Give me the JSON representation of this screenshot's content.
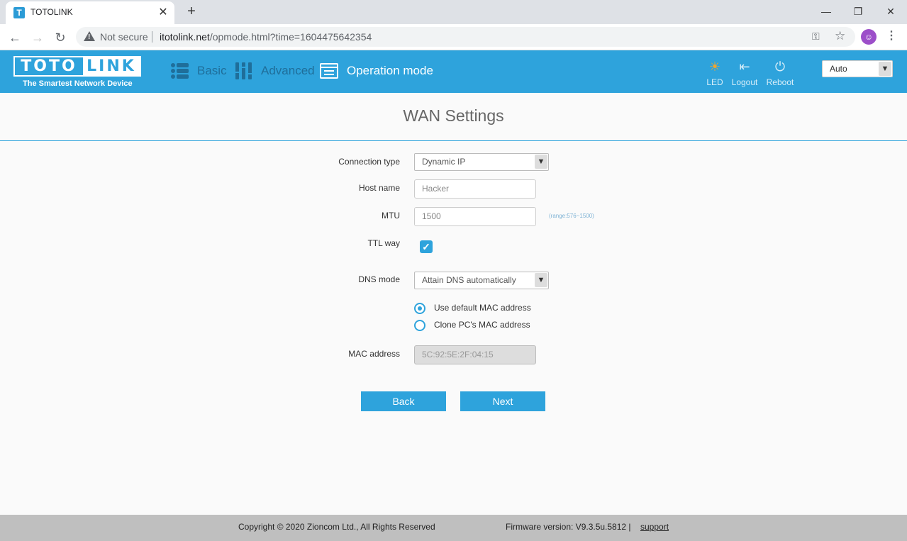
{
  "browser": {
    "tab_title": "TOTOLINK",
    "tab_icon": "T",
    "security_label": "Not secure",
    "url_host": "itotolink.net",
    "url_path": "/opmode.html?time=1604475642354"
  },
  "header": {
    "logo_left": "TOTO",
    "logo_right": "LINK",
    "tagline": "The Smartest Network Device",
    "nav": {
      "basic": "Basic",
      "advanced": "Advanced",
      "operation_mode": "Operation mode"
    },
    "actions": {
      "led": "LED",
      "logout": "Logout",
      "reboot": "Reboot"
    },
    "language": "Auto",
    "brand_color": "#2ea3dc"
  },
  "page": {
    "title": "WAN Settings",
    "fields": {
      "connection_type_label": "Connection type",
      "connection_type_value": "Dynamic IP",
      "host_name_label": "Host name",
      "host_name_placeholder": "Hacker",
      "mtu_label": "MTU",
      "mtu_value": "1500",
      "mtu_range": "(range:576~1500)",
      "ttl_label": "TTL way",
      "ttl_checked": true,
      "dns_mode_label": "DNS mode",
      "dns_mode_value": "Attain DNS automatically",
      "mac_option_default": "Use default MAC address",
      "mac_option_clone": "Clone PC's MAC address",
      "mac_address_label": "MAC address",
      "mac_address_value": "5C:92:5E:2F:04:15"
    },
    "buttons": {
      "back": "Back",
      "next": "Next"
    }
  },
  "footer": {
    "copyright": "Copyright © 2020 Zioncom Ltd., All Rights Reserved",
    "firmware": "Firmware version: V9.3.5u.5812  |",
    "support": "support"
  }
}
